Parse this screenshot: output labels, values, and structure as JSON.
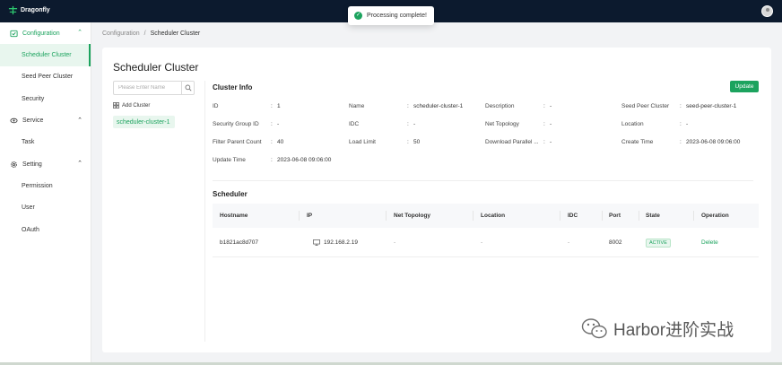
{
  "app": {
    "name": "Dragonfly"
  },
  "toast": {
    "message": "Processing complete!"
  },
  "sidebar": {
    "groups": [
      {
        "label": "Configuration",
        "items": [
          "Scheduler Cluster",
          "Seed Peer Cluster",
          "Security"
        ]
      },
      {
        "label": "Service",
        "items": [
          "Task"
        ]
      },
      {
        "label": "Setting",
        "items": [
          "Permission",
          "User",
          "OAuth"
        ]
      }
    ]
  },
  "breadcrumb": {
    "parent": "Configuration",
    "separator": "/",
    "current": "Scheduler Cluster"
  },
  "page": {
    "title": "Scheduler Cluster"
  },
  "search": {
    "placeholder": "Please Enter Name"
  },
  "add_cluster_label": "Add Cluster",
  "clusters": [
    "scheduler-cluster-1"
  ],
  "cluster_info": {
    "title": "Cluster Info",
    "update_label": "Update",
    "fields": [
      {
        "label": "ID",
        "value": "1"
      },
      {
        "label": "Name",
        "value": "scheduler-cluster-1"
      },
      {
        "label": "Description",
        "value": "-"
      },
      {
        "label": "Seed Peer Cluster",
        "value": "seed-peer-cluster-1"
      },
      {
        "label": "Security Group ID",
        "value": "-"
      },
      {
        "label": "IDC",
        "value": "-"
      },
      {
        "label": "Net Topology",
        "value": "-"
      },
      {
        "label": "Location",
        "value": "-"
      },
      {
        "label": "Filter Parent Count",
        "value": "40"
      },
      {
        "label": "Load Limit",
        "value": "50"
      },
      {
        "label": "Download Parallel ...",
        "value": "-"
      },
      {
        "label": "Create Time",
        "value": "2023-06-08 09:06:00"
      },
      {
        "label": "Update Time",
        "value": "2023-06-08 09:06:00"
      }
    ]
  },
  "scheduler": {
    "title": "Scheduler",
    "columns": [
      "Hostname",
      "IP",
      "Net Topology",
      "Location",
      "IDC",
      "Port",
      "State",
      "Operation"
    ],
    "rows": [
      {
        "hostname": "b1821ac8d707",
        "ip": "192.168.2.19",
        "net_topology": "-",
        "location": "-",
        "idc": "-",
        "port": "8002",
        "state": "ACTIVE",
        "operation": "Delete"
      }
    ]
  },
  "watermark": {
    "text": "Harbor进阶实战"
  },
  "colors": {
    "brand": "#1ca35e",
    "topbar": "#0c1a2e"
  }
}
